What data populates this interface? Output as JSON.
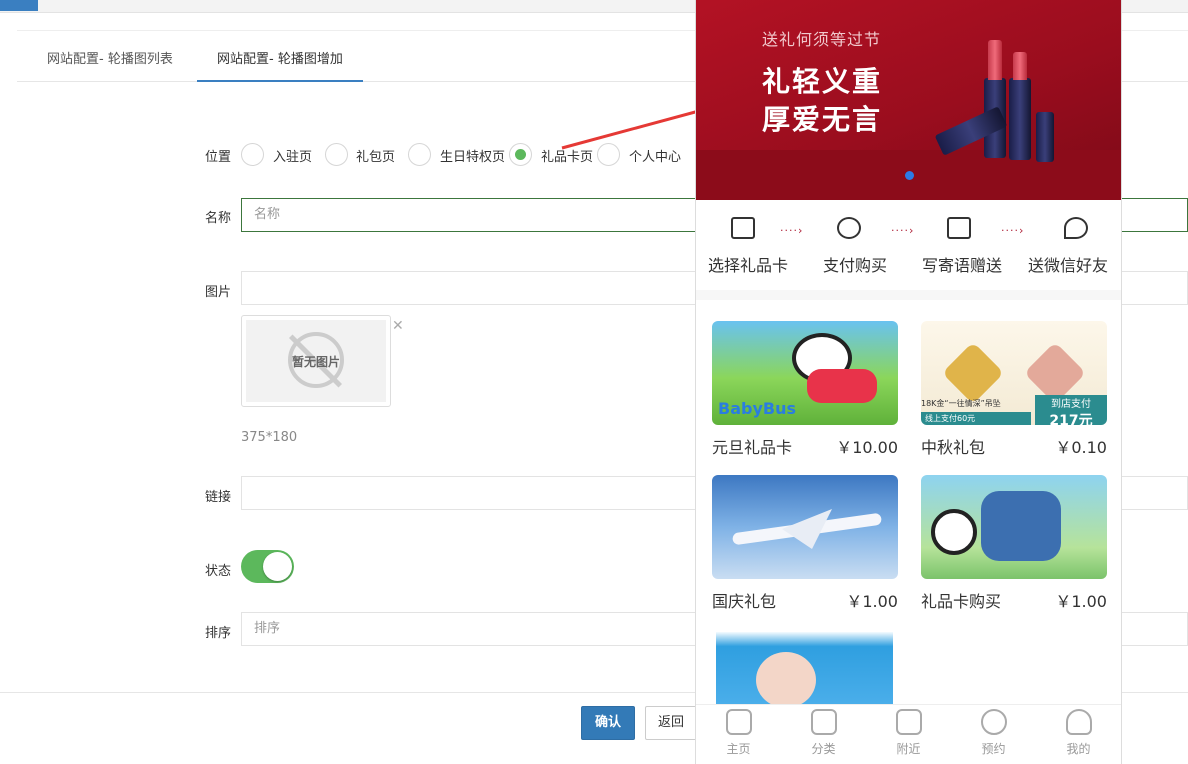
{
  "tabs": {
    "list": "网站配置- 轮播图列表",
    "add": "网站配置- 轮播图增加"
  },
  "form": {
    "position_label": "位置",
    "positions": [
      "入驻页",
      "礼包页",
      "生日特权页",
      "礼品卡页",
      "个人中心"
    ],
    "selected_position": "礼品卡页",
    "name_label": "名称",
    "name_placeholder": "名称",
    "image_label": "图片",
    "no_image_text": "暂无图片",
    "image_size_hint": "375*180",
    "link_label": "链接",
    "status_label": "状态",
    "status_on": true,
    "sort_label": "排序",
    "sort_placeholder": "排序"
  },
  "actions": {
    "confirm": "确认",
    "back": "返回"
  },
  "preview": {
    "banner": {
      "subtitle": "送礼何须等过节",
      "line1": "礼轻义重",
      "line2": "厚爱无言"
    },
    "steps": [
      "选择礼品卡",
      "支付购买",
      "写寄语赠送",
      "送微信好友"
    ],
    "products": [
      {
        "name": "元旦礼品卡",
        "price": "￥10.00",
        "image_text": "BabyBus"
      },
      {
        "name": "中秋礼包",
        "price": "￥0.10",
        "image_text": "18K金“一往情深”吊坠",
        "badge": "到店支付",
        "badge_price": "217元",
        "sub_badge": "线上支付60元"
      },
      {
        "name": "国庆礼包",
        "price": "￥1.00"
      },
      {
        "name": "礼品卡购买",
        "price": "￥1.00"
      }
    ],
    "tabbar": [
      "主页",
      "分类",
      "附近",
      "预约",
      "我的"
    ]
  },
  "colors": {
    "primary": "#337ab7",
    "success": "#5cb85c",
    "banner_red": "#a50f20"
  }
}
